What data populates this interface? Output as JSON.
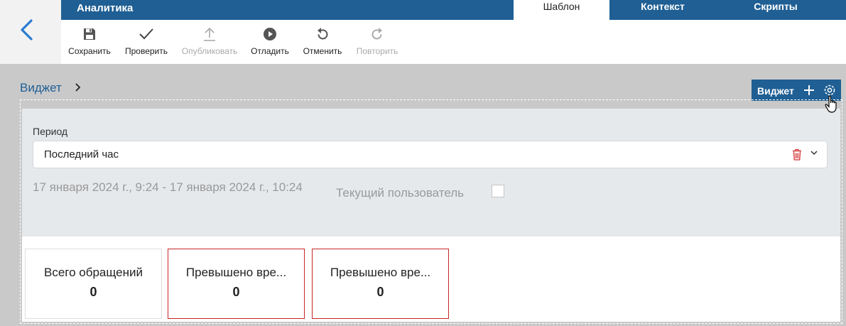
{
  "header": {
    "app_title": "Аналитика",
    "tabs": [
      {
        "label": "Шаблон",
        "active": true
      },
      {
        "label": "Контекст",
        "active": false
      },
      {
        "label": "Скрипты",
        "active": false
      }
    ]
  },
  "toolbar": {
    "save": "Сохранить",
    "check": "Проверить",
    "publish": "Опубликовать",
    "debug": "Отладить",
    "undo": "Отменить",
    "redo": "Повторить"
  },
  "breadcrumb": {
    "label": "Виджет"
  },
  "widget_button": {
    "label": "Виджет"
  },
  "filter": {
    "period_label": "Период",
    "period_value": "Последний час",
    "date_range": "17 января 2024 г., 9:24 - 17 января 2024 г., 10:24",
    "current_user_label": "Текущий пользователь",
    "current_user_checked": false
  },
  "cards": [
    {
      "title": "Всего обращений",
      "value": "0"
    },
    {
      "title": "Превышено вре...",
      "value": "0"
    },
    {
      "title": "Превышено вре...",
      "value": "0"
    }
  ],
  "colors": {
    "brand": "#1f5f94",
    "alert_border": "#c62828",
    "delete_icon": "#d32f2f"
  },
  "icons": [
    "back-arrow-icon",
    "floppy-disk-icon",
    "checkmark-icon",
    "upload-icon",
    "play-circle-icon",
    "undo-icon",
    "redo-icon",
    "chevron-right-icon",
    "plus-icon",
    "gear-icon",
    "hand-cursor-icon",
    "trash-icon",
    "chevron-down-icon"
  ]
}
